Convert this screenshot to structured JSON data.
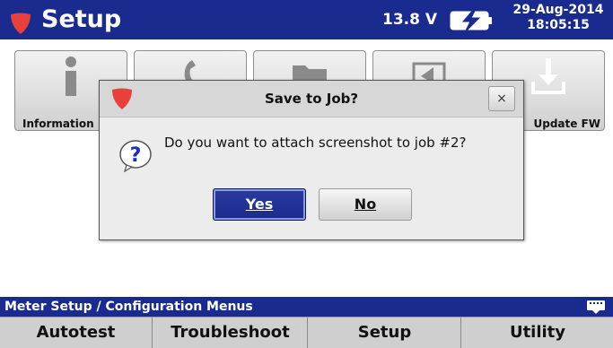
{
  "header": {
    "title": "Setup",
    "voltage": "13.8 V",
    "date": "29-Aug-2014",
    "time": "18:05:15"
  },
  "menu": {
    "items": [
      {
        "label": "Information",
        "icon": "info-icon"
      },
      {
        "label": "",
        "icon": "phone-icon"
      },
      {
        "label": "",
        "icon": "folder-icon"
      },
      {
        "label": "",
        "icon": "display-icon"
      },
      {
        "label": "Update FW",
        "icon": "download-icon"
      }
    ]
  },
  "dialog": {
    "title": "Save to Job?",
    "close_label": "×",
    "message": "Do you want to attach screenshot to job #2?",
    "yes_label": "Yes",
    "no_label": "No"
  },
  "crumb": {
    "text": "Meter Setup / Configuration Menus"
  },
  "tabs": [
    {
      "label": "Autotest"
    },
    {
      "label": "Troubleshoot"
    },
    {
      "label": "Setup"
    },
    {
      "label": "Utility"
    }
  ],
  "colors": {
    "header_bg": "#1a2b8f",
    "brand_red": "#e8403a",
    "charging": "#ffd200"
  }
}
